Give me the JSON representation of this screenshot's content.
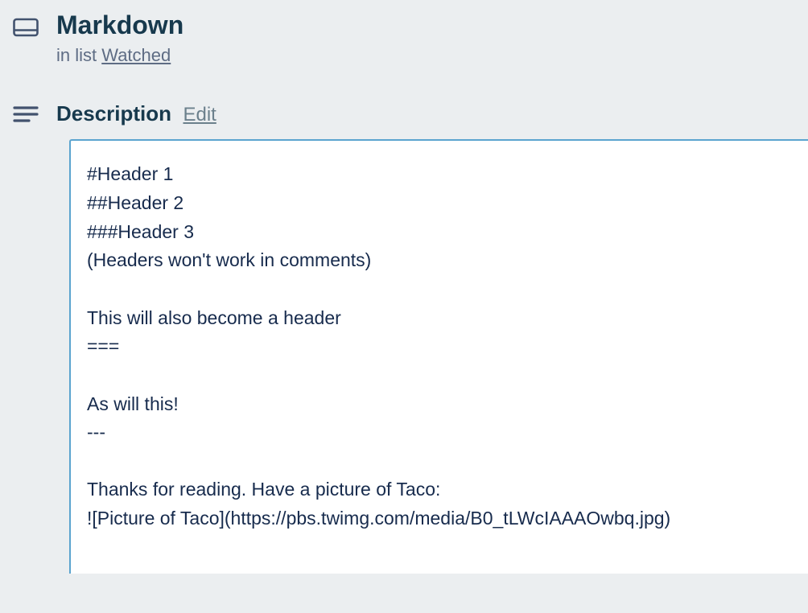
{
  "card": {
    "title": "Markdown",
    "list_prefix": "in list ",
    "list_name": "Watched"
  },
  "description": {
    "label": "Description",
    "edit_label": "Edit",
    "content": "#Header 1\n##Header 2\n###Header 3\n(Headers won't work in comments)\n\nThis will also become a header\n===\n\nAs will this!\n---\n\nThanks for reading. Have a picture of Taco:\n![Picture of Taco](https://pbs.twimg.com/media/B0_tLWcIAAAOwbq.jpg)"
  }
}
